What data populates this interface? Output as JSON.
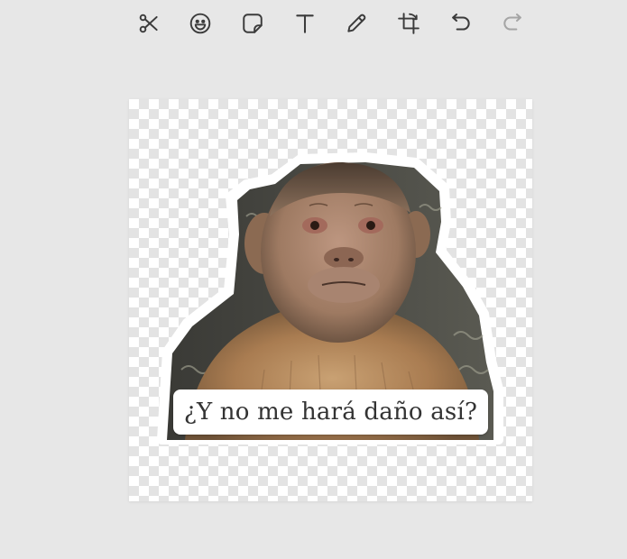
{
  "toolbar": {
    "tools": [
      {
        "icon": "scissors-icon",
        "label": "Cut"
      },
      {
        "icon": "emoji-icon",
        "label": "Emoji"
      },
      {
        "icon": "sticker-icon",
        "label": "Sticker"
      },
      {
        "icon": "text-icon",
        "label": "Text"
      },
      {
        "icon": "pencil-icon",
        "label": "Draw"
      },
      {
        "icon": "crop-icon",
        "label": "Crop"
      },
      {
        "icon": "undo-icon",
        "label": "Undo"
      },
      {
        "icon": "redo-icon",
        "label": "Redo",
        "disabled": true
      }
    ]
  },
  "canvas": {
    "caption": "¿Y no me hará daño así?"
  },
  "colors": {
    "background": "#e7e7e7",
    "icon": "#3b3b3b",
    "sticker_outline": "#ffffff",
    "caption_text": "#333333"
  }
}
